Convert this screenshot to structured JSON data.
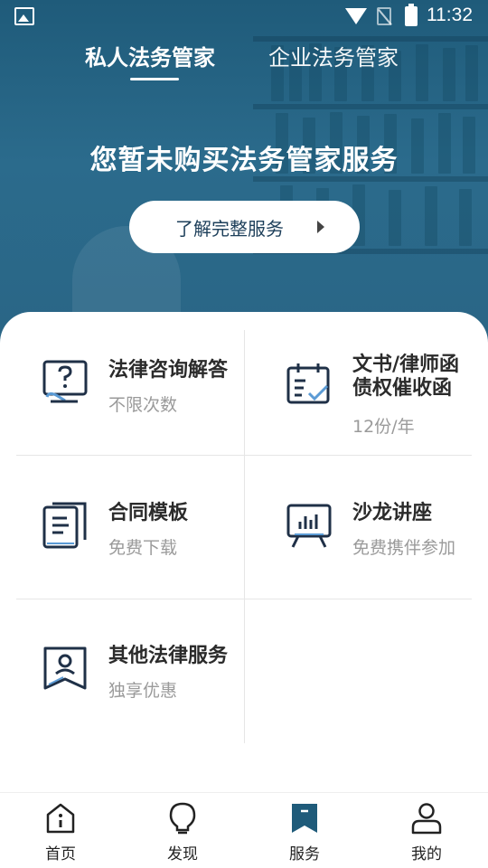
{
  "status_bar": {
    "time": "11:32"
  },
  "tabs": [
    {
      "label": "私人法务管家",
      "active": true
    },
    {
      "label": "企业法务管家",
      "active": false
    }
  ],
  "hero": {
    "title": "您暂未购买法务管家服务",
    "cta_label": "了解完整服务"
  },
  "services": [
    {
      "title": "法律咨询解答",
      "subtitle": "不限次数",
      "icon": "question-screen-icon"
    },
    {
      "title": "文书/律师函\n债权催收函",
      "subtitle": "12份/年",
      "icon": "calendar-check-icon"
    },
    {
      "title": "合同模板",
      "subtitle": "免费下载",
      "icon": "document-stack-icon"
    },
    {
      "title": "沙龙讲座",
      "subtitle": "免费携伴参加",
      "icon": "presentation-board-icon"
    },
    {
      "title": "其他法律服务",
      "subtitle": "独享优惠",
      "icon": "person-badge-icon"
    }
  ],
  "bottom_nav": [
    {
      "label": "首页",
      "icon": "info-home-icon",
      "active": false
    },
    {
      "label": "发现",
      "icon": "lightbulb-icon",
      "active": false
    },
    {
      "label": "服务",
      "icon": "bookmark-icon",
      "active": true
    },
    {
      "label": "我的",
      "icon": "user-icon",
      "active": false
    }
  ],
  "colors": {
    "hero_bg": "#2b6b8c",
    "icon_dark": "#1f3047",
    "icon_accent": "#5b9bd5",
    "nav_active": "#1f5b7a"
  }
}
